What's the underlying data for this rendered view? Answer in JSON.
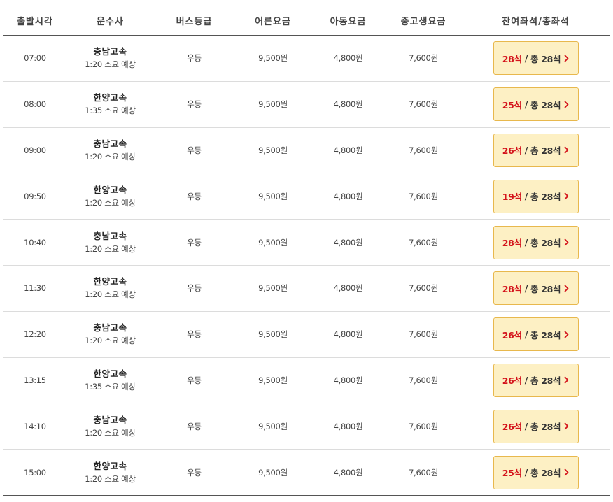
{
  "columns": {
    "depart_time": "출발시각",
    "company": "운수사",
    "grade": "버스등급",
    "adult_fare": "어른요금",
    "child_fare": "아동요금",
    "student_fare": "중고생요금",
    "seats": "잔여좌석/총좌석"
  },
  "icons": {
    "seat_button": "chevron-right-icon"
  },
  "colors": {
    "remaining_seats": "#d4141c",
    "button_bg": "#fdf0c4",
    "button_border": "#e8b84d"
  },
  "rows": [
    {
      "time": "07:00",
      "company": "충남고속",
      "duration": "1:20 소요 예상",
      "grade": "우등",
      "adult": "9,500원",
      "child": "4,800원",
      "student": "7,600원",
      "remaining": "28석",
      "sep": "/",
      "total": "총 28석"
    },
    {
      "time": "08:00",
      "company": "한양고속",
      "duration": "1:35 소요 예상",
      "grade": "우등",
      "adult": "9,500원",
      "child": "4,800원",
      "student": "7,600원",
      "remaining": "25석",
      "sep": "/",
      "total": "총 28석"
    },
    {
      "time": "09:00",
      "company": "충남고속",
      "duration": "1:20 소요 예상",
      "grade": "우등",
      "adult": "9,500원",
      "child": "4,800원",
      "student": "7,600원",
      "remaining": "26석",
      "sep": "/",
      "total": "총 28석"
    },
    {
      "time": "09:50",
      "company": "한양고속",
      "duration": "1:20 소요 예상",
      "grade": "우등",
      "adult": "9,500원",
      "child": "4,800원",
      "student": "7,600원",
      "remaining": "19석",
      "sep": "/",
      "total": "총 28석"
    },
    {
      "time": "10:40",
      "company": "충남고속",
      "duration": "1:20 소요 예상",
      "grade": "우등",
      "adult": "9,500원",
      "child": "4,800원",
      "student": "7,600원",
      "remaining": "28석",
      "sep": "/",
      "total": "총 28석"
    },
    {
      "time": "11:30",
      "company": "한양고속",
      "duration": "1:20 소요 예상",
      "grade": "우등",
      "adult": "9,500원",
      "child": "4,800원",
      "student": "7,600원",
      "remaining": "28석",
      "sep": "/",
      "total": "총 28석"
    },
    {
      "time": "12:20",
      "company": "충남고속",
      "duration": "1:20 소요 예상",
      "grade": "우등",
      "adult": "9,500원",
      "child": "4,800원",
      "student": "7,600원",
      "remaining": "26석",
      "sep": "/",
      "total": "총 28석"
    },
    {
      "time": "13:15",
      "company": "한양고속",
      "duration": "1:35 소요 예상",
      "grade": "우등",
      "adult": "9,500원",
      "child": "4,800원",
      "student": "7,600원",
      "remaining": "26석",
      "sep": "/",
      "total": "총 28석"
    },
    {
      "time": "14:10",
      "company": "충남고속",
      "duration": "1:20 소요 예상",
      "grade": "우등",
      "adult": "9,500원",
      "child": "4,800원",
      "student": "7,600원",
      "remaining": "26석",
      "sep": "/",
      "total": "총 28석"
    },
    {
      "time": "15:00",
      "company": "한양고속",
      "duration": "1:20 소요 예상",
      "grade": "우등",
      "adult": "9,500원",
      "child": "4,800원",
      "student": "7,600원",
      "remaining": "25석",
      "sep": "/",
      "total": "총 28석"
    }
  ]
}
